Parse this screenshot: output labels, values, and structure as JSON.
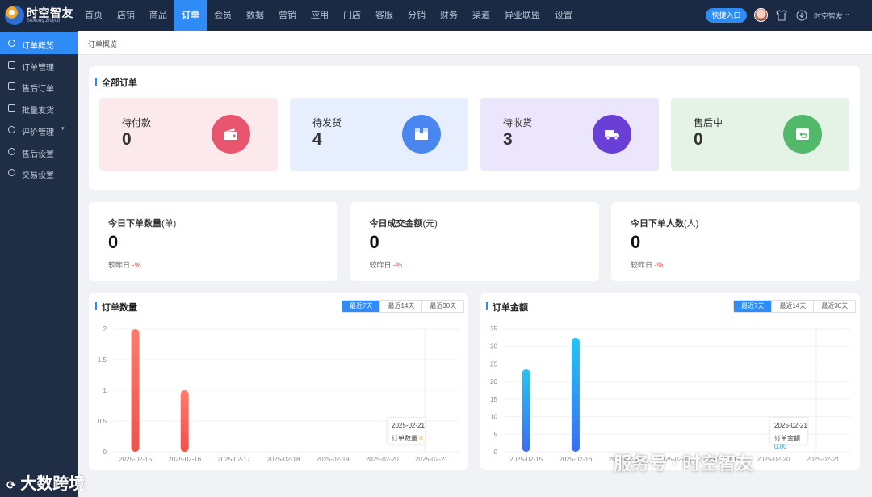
{
  "brand": {
    "name": "时空智友",
    "sub": "Shikong Zhiyou"
  },
  "nav": [
    "首页",
    "店铺",
    "商品",
    "订单",
    "会员",
    "数据",
    "营销",
    "应用",
    "门店",
    "客服",
    "分销",
    "财务",
    "渠道",
    "异业联盟",
    "设置"
  ],
  "nav_active": "订单",
  "topbar": {
    "quick_entry": "快捷入口",
    "user_name": "时空智友"
  },
  "sidebar": [
    {
      "label": "订单概览",
      "icon": "clock-icon",
      "active": true
    },
    {
      "label": "订单管理",
      "icon": "document-icon"
    },
    {
      "label": "售后订单",
      "icon": "grid-icon"
    },
    {
      "label": "批量发货",
      "icon": "checklist-icon"
    },
    {
      "label": "评价管理",
      "icon": "comment-icon",
      "has_children": true
    },
    {
      "label": "售后设置",
      "icon": "globe-icon"
    },
    {
      "label": "交易设置",
      "icon": "settings-icon"
    }
  ],
  "breadcrumb": "订单概览",
  "all_orders": {
    "title": "全部订单",
    "cards": [
      {
        "label": "待付款",
        "value": "0",
        "icon": "wallet-icon",
        "bg": "#fbe9ec",
        "color": "#e8556f"
      },
      {
        "label": "待发货",
        "value": "4",
        "icon": "package-icon",
        "bg": "#e7efff",
        "color": "#4a86f0"
      },
      {
        "label": "待收货",
        "value": "3",
        "icon": "truck-icon",
        "bg": "#ebe6fb",
        "color": "#6a3fd6"
      },
      {
        "label": "售后中",
        "value": "0",
        "icon": "return-icon",
        "bg": "#e4f3e6",
        "color": "#52b86a"
      }
    ]
  },
  "stats": [
    {
      "label": "今日下单数量",
      "unit": "(单)",
      "value": "0",
      "compare": "较昨日",
      "pct": "-%"
    },
    {
      "label": "今日成交金额",
      "unit": "(元)",
      "value": "0",
      "compare": "较昨日",
      "pct": "-%"
    },
    {
      "label": "今日下单人数",
      "unit": "(人)",
      "value": "0",
      "compare": "较昨日",
      "pct": "-%"
    }
  ],
  "range_options": [
    "最近7天",
    "最近14天",
    "最近30天"
  ],
  "chart_data": [
    {
      "type": "bar",
      "title": "订单数量",
      "categories": [
        "2025-02-15",
        "2025-02-16",
        "2025-02-17",
        "2025-02-18",
        "2025-02-19",
        "2025-02-20",
        "2025-02-21"
      ],
      "values": [
        2,
        1,
        0,
        0,
        0,
        0,
        0
      ],
      "ylim": [
        0,
        2
      ],
      "yticks": [
        "0",
        "0.5",
        "1",
        "1.5",
        "2"
      ],
      "color_top": "#ff7b6b",
      "color_bottom": "#f0524a",
      "tooltip": {
        "date": "2025-02-21",
        "label": "订单数量",
        "value": "0"
      }
    },
    {
      "type": "bar",
      "title": "订单金额",
      "categories": [
        "2025-02-15",
        "2025-02-16",
        "2025-02-17",
        "2025-02-18",
        "2025-02-19",
        "2025-02-20",
        "2025-02-21"
      ],
      "values": [
        23.5,
        32.5,
        0,
        0,
        0,
        0,
        0
      ],
      "ylim": [
        0,
        35
      ],
      "yticks": [
        "0",
        "5",
        "10",
        "15",
        "20",
        "25",
        "30",
        "35"
      ],
      "color_top": "#27c4f2",
      "color_bottom": "#3b6df0",
      "tooltip": {
        "date": "2025-02-21",
        "label": "订单金额",
        "value": "0.00"
      }
    }
  ],
  "watermarks": {
    "left": "大数跨境",
    "right": "服务号 · 时空智友"
  }
}
